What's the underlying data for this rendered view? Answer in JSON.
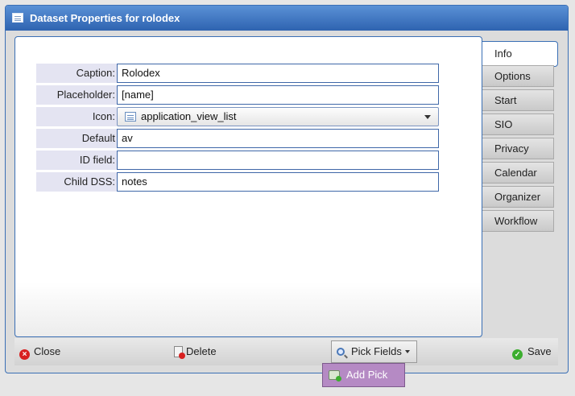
{
  "window": {
    "title": "Dataset Properties for rolodex"
  },
  "form": {
    "caption": {
      "label": "Caption:",
      "value": "Rolodex"
    },
    "placeholder": {
      "label": "Placeholder:",
      "value": "[name]"
    },
    "icon": {
      "label": "Icon:",
      "value": "application_view_list",
      "icon": "list-icon"
    },
    "default": {
      "label": "Default",
      "value": "av"
    },
    "id_field": {
      "label": "ID field:",
      "value": ""
    },
    "child_dss": {
      "label": "Child DSS:",
      "value": "notes"
    }
  },
  "tabs": [
    {
      "label": "Info",
      "active": true
    },
    {
      "label": "Options"
    },
    {
      "label": "Start"
    },
    {
      "label": "SIO"
    },
    {
      "label": "Privacy"
    },
    {
      "label": "Calendar"
    },
    {
      "label": "Organizer"
    },
    {
      "label": "Workflow"
    }
  ],
  "footer": {
    "close_label": "Close",
    "delete_label": "Delete",
    "pick_fields_label": "Pick Fields",
    "save_label": "Save"
  },
  "menu": {
    "add_pick_label": "Add Pick"
  },
  "colors": {
    "title_bar": "#2e63b0",
    "border": "#3a6fb5",
    "menu_highlight": "#b58ac4"
  }
}
